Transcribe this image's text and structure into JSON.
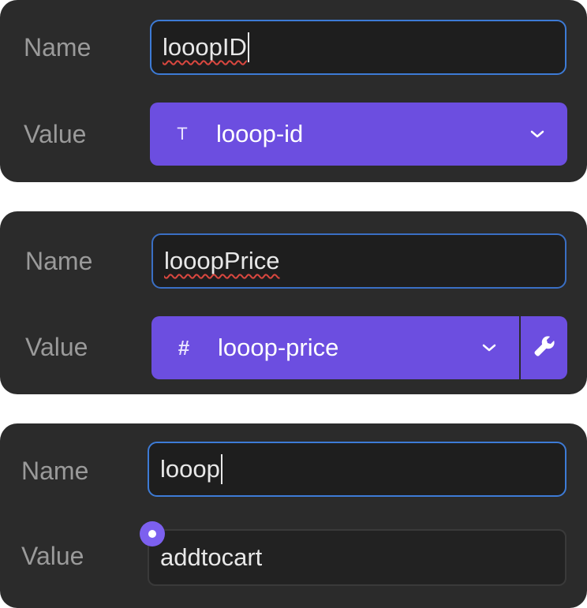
{
  "panels": [
    {
      "name_label": "Name",
      "value_label": "Value",
      "name_value": "looopID",
      "type_icon": "T",
      "type_icon_name": "text-type-icon",
      "value": "looop-id"
    },
    {
      "name_label": "Name",
      "value_label": "Value",
      "name_value": "looopPrice",
      "type_icon": "#",
      "type_icon_name": "number-type-icon",
      "value": "looop-price"
    },
    {
      "name_label": "Name",
      "value_label": "Value",
      "name_value": "looop",
      "value": "addtocart"
    }
  ],
  "colors": {
    "panel_bg": "#2b2b2b",
    "accent_purple": "#6c4ee0",
    "focus_border": "#3d7bd6",
    "spellcheck_underline": "#d9473f",
    "label_text": "#9a9a9a"
  }
}
